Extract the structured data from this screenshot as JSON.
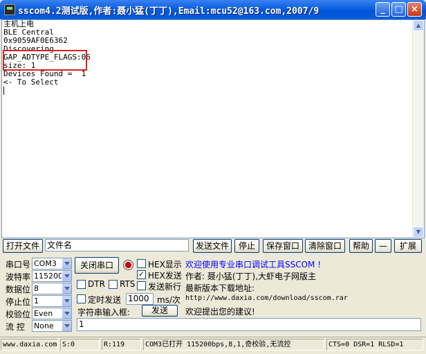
{
  "window": {
    "title": "sscom4.2测试版,作者:聂小猛(丁丁),Email:mcu52@163.com,2007/9",
    "minimize": "_",
    "maximize": "□",
    "close": "×"
  },
  "output": {
    "lines": [
      "主机上电",
      "BLE Central",
      "0x9059AF0E6362",
      "Discovering",
      "GAP_ADTYPE_FLAGS:06",
      "size: 1",
      "Devices Found =  1",
      "<- To Select"
    ]
  },
  "toolbar": {
    "open_file": "打开文件",
    "filename": "文件名",
    "send_file": "发送文件",
    "stop": "停止",
    "save_window": "保存窗口",
    "clear_window": "清除窗口",
    "help": "帮助",
    "dash": "—",
    "expand": "扩展"
  },
  "config": {
    "port_label": "串口号",
    "port_value": "COM3",
    "baud_label": "波特率",
    "baud_value": "115200",
    "data_label": "数据位",
    "data_value": "8",
    "stop_label": "停止位",
    "stop_value": "1",
    "parity_label": "校验位",
    "parity_value": "Even",
    "flow_label": "流 控",
    "flow_value": "None",
    "close_port": "关闭串口",
    "hex_display": "HEX显示",
    "hex_send": "HEX发送",
    "send_newline": "发送新行",
    "dtr": "DTR",
    "rts": "RTS",
    "timed_send": "定时发送",
    "interval": "1000",
    "interval_unit": "ms/次",
    "input_label": "字符串输入框:",
    "send_button": "发送",
    "input_value": "1",
    "hex_send_checked": "✓"
  },
  "info": {
    "line1": "欢迎使用专业串口调试工具SSCOM !",
    "line2": "作者: 聂小猛(丁丁),大虾电子网版主",
    "line3": "最新版本下载地址:",
    "line4": "http://www.daxia.com/download/sscom.rar",
    "line5": "欢迎提出您的建议!"
  },
  "status": {
    "site": "www.daxia.com",
    "sent": "S:0",
    "received": "R:119",
    "port_state": "COM3已打开  115200bps,8,1,奇校验,无流控",
    "lines": "CTS=0 DSR=1 RLSD=1"
  },
  "colors": {
    "title_bar": "#0a5fe0",
    "highlight_box": "#e02020",
    "info_text_blue": "#0000ff"
  }
}
